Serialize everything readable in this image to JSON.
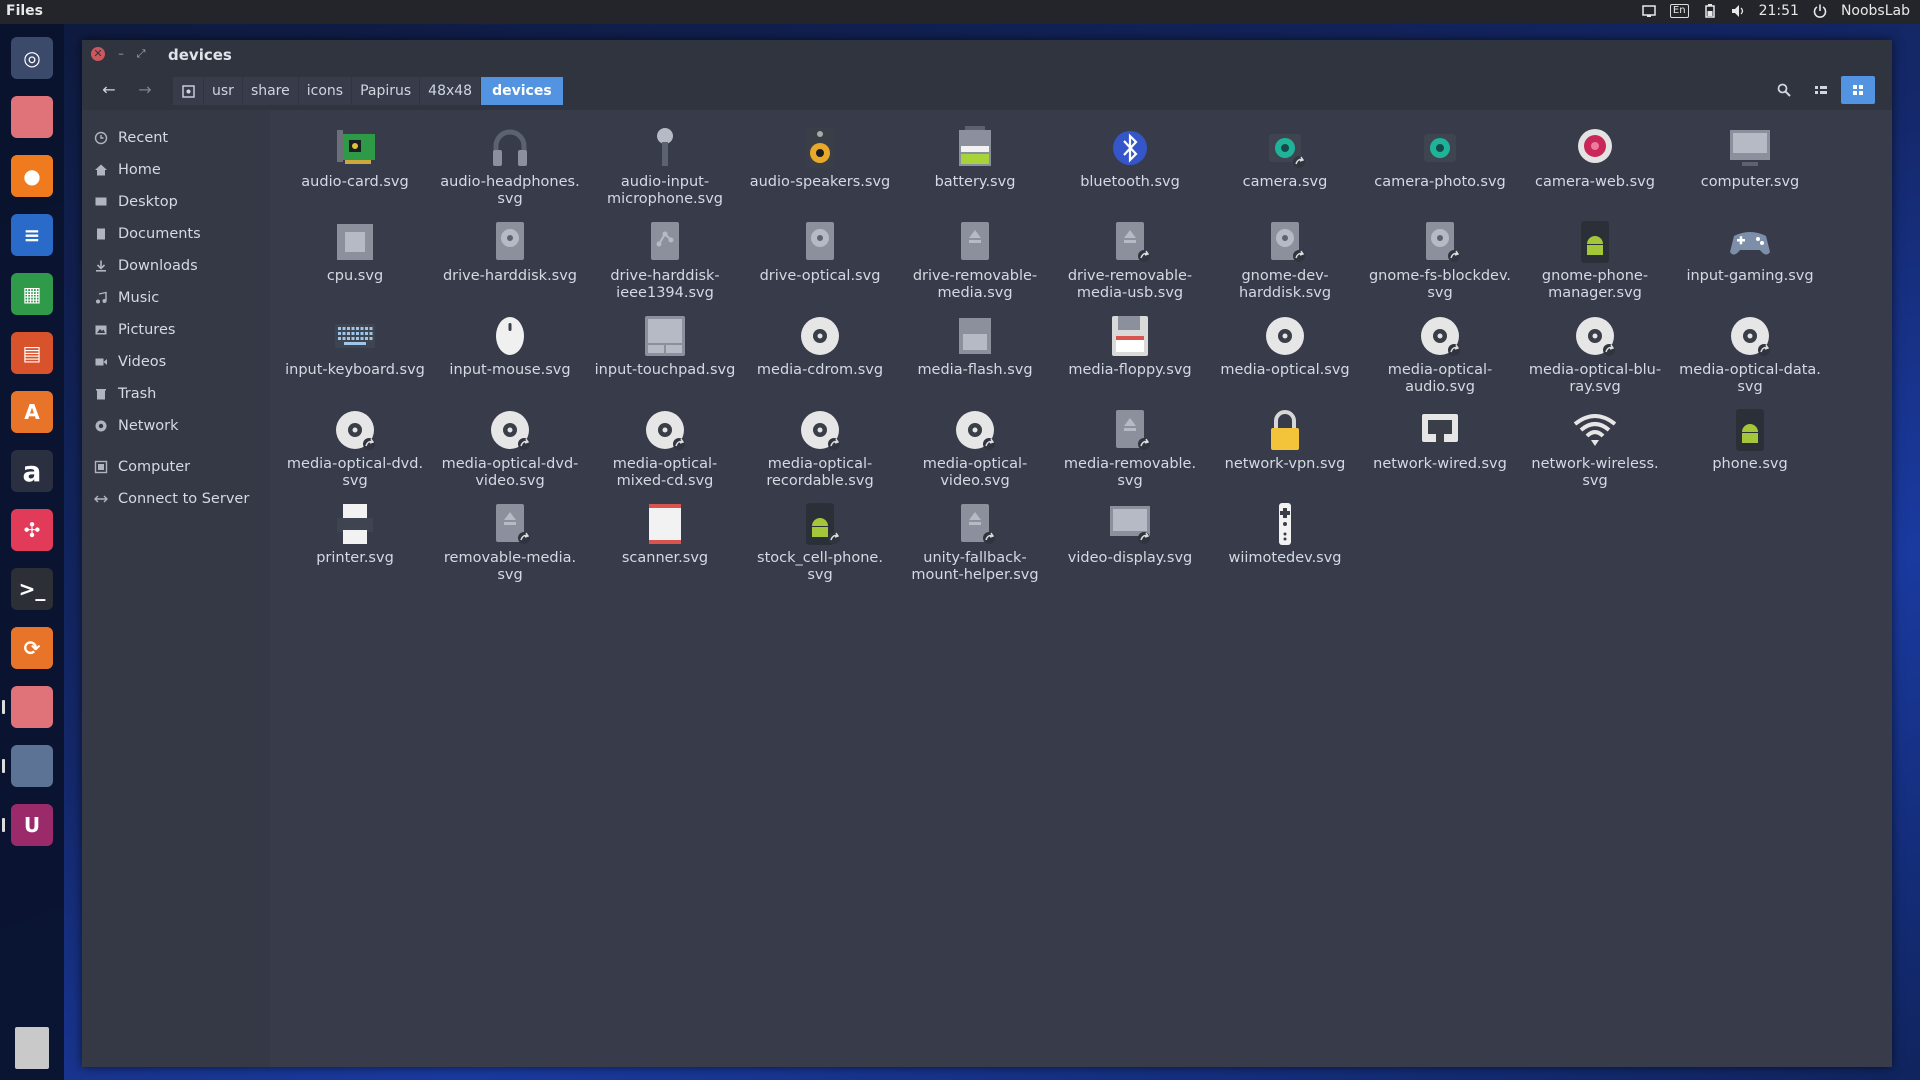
{
  "top_panel": {
    "app_name": "Files",
    "lang": "En",
    "clock": "21:51",
    "user": "NoobsLab"
  },
  "launcher": [
    {
      "name": "dash-icon",
      "color": "#3b4a6b"
    },
    {
      "name": "files-icon",
      "color": "#e0737a"
    },
    {
      "name": "firefox-icon",
      "color": "#f07b1f"
    },
    {
      "name": "writer-icon",
      "color": "#2a6ac8"
    },
    {
      "name": "calc-icon",
      "color": "#2f9a4a"
    },
    {
      "name": "impress-icon",
      "color": "#d8532c"
    },
    {
      "name": "software-center-icon",
      "color": "#e8742a"
    },
    {
      "name": "amazon-icon",
      "color": "#2b3040"
    },
    {
      "name": "slides-icon",
      "color": "#e23b5a"
    },
    {
      "name": "terminal-icon",
      "color": "#2c2f36"
    },
    {
      "name": "update-icon",
      "color": "#e8742a"
    },
    {
      "name": "files-running-icon",
      "color": "#e0737a"
    },
    {
      "name": "screenshot-icon",
      "color": "#5d7396"
    },
    {
      "name": "unity-tweak-icon",
      "color": "#9b2a6b"
    },
    {
      "name": "trash-icon",
      "color": "#c9c9c9"
    }
  ],
  "window": {
    "title": "devices",
    "breadcrumbs": [
      "usr",
      "share",
      "icons",
      "Papirus",
      "48x48",
      "devices"
    ]
  },
  "sidebar": {
    "items": [
      {
        "label": "Recent",
        "icon": "clock-icon"
      },
      {
        "label": "Home",
        "icon": "home-icon"
      },
      {
        "label": "Desktop",
        "icon": "desktop-icon"
      },
      {
        "label": "Documents",
        "icon": "documents-icon"
      },
      {
        "label": "Downloads",
        "icon": "download-icon"
      },
      {
        "label": "Music",
        "icon": "music-icon"
      },
      {
        "label": "Pictures",
        "icon": "pictures-icon"
      },
      {
        "label": "Videos",
        "icon": "videos-icon"
      },
      {
        "label": "Trash",
        "icon": "trash-icon"
      },
      {
        "label": "Network",
        "icon": "network-icon"
      },
      {
        "label": "Computer",
        "icon": "computer-icon"
      },
      {
        "label": "Connect to Server",
        "icon": "connect-server-icon"
      }
    ]
  },
  "files": [
    {
      "name": "audio-card.svg",
      "icon": "audio-card-icon"
    },
    {
      "name": "audio-headphones.svg",
      "icon": "headphones-icon"
    },
    {
      "name": "audio-input-microphone.svg",
      "icon": "microphone-icon"
    },
    {
      "name": "audio-speakers.svg",
      "icon": "speaker-icon"
    },
    {
      "name": "battery.svg",
      "icon": "battery-icon"
    },
    {
      "name": "bluetooth.svg",
      "icon": "bluetooth-icon"
    },
    {
      "name": "camera.svg",
      "icon": "camera-icon"
    },
    {
      "name": "camera-photo.svg",
      "icon": "camera-photo-icon"
    },
    {
      "name": "camera-web.svg",
      "icon": "webcam-icon"
    },
    {
      "name": "computer.svg",
      "icon": "computer-icon"
    },
    {
      "name": "cpu.svg",
      "icon": "cpu-icon"
    },
    {
      "name": "drive-harddisk.svg",
      "icon": "harddisk-icon"
    },
    {
      "name": "drive-harddisk-ieee1394.svg",
      "icon": "harddisk-ieee1394-icon"
    },
    {
      "name": "drive-optical.svg",
      "icon": "optical-drive-icon"
    },
    {
      "name": "drive-removable-media.svg",
      "icon": "removable-drive-icon"
    },
    {
      "name": "drive-removable-media-usb.svg",
      "icon": "removable-usb-icon"
    },
    {
      "name": "gnome-dev-harddisk.svg",
      "icon": "harddisk-link-icon"
    },
    {
      "name": "gnome-fs-blockdev.svg",
      "icon": "blockdev-icon"
    },
    {
      "name": "gnome-phone-manager.svg",
      "icon": "android-phone-icon"
    },
    {
      "name": "input-gaming.svg",
      "icon": "gamepad-icon"
    },
    {
      "name": "input-keyboard.svg",
      "icon": "keyboard-icon"
    },
    {
      "name": "input-mouse.svg",
      "icon": "mouse-icon"
    },
    {
      "name": "input-touchpad.svg",
      "icon": "touchpad-icon"
    },
    {
      "name": "media-cdrom.svg",
      "icon": "disc-icon"
    },
    {
      "name": "media-flash.svg",
      "icon": "flash-card-icon"
    },
    {
      "name": "media-floppy.svg",
      "icon": "floppy-icon"
    },
    {
      "name": "media-optical.svg",
      "icon": "disc-icon"
    },
    {
      "name": "media-optical-audio.svg",
      "icon": "disc-link-icon"
    },
    {
      "name": "media-optical-blu-ray.svg",
      "icon": "disc-link-icon"
    },
    {
      "name": "media-optical-data.svg",
      "icon": "disc-link-icon"
    },
    {
      "name": "media-optical-dvd.svg",
      "icon": "disc-link-icon"
    },
    {
      "name": "media-optical-dvd-video.svg",
      "icon": "disc-link-icon"
    },
    {
      "name": "media-optical-mixed-cd.svg",
      "icon": "disc-link-icon"
    },
    {
      "name": "media-optical-recordable.svg",
      "icon": "disc-link-icon"
    },
    {
      "name": "media-optical-video.svg",
      "icon": "disc-link-icon"
    },
    {
      "name": "media-removable.svg",
      "icon": "removable-drive-link-icon"
    },
    {
      "name": "network-vpn.svg",
      "icon": "lock-icon"
    },
    {
      "name": "network-wired.svg",
      "icon": "ethernet-icon"
    },
    {
      "name": "network-wireless.svg",
      "icon": "wifi-icon"
    },
    {
      "name": "phone.svg",
      "icon": "android-phone-icon"
    },
    {
      "name": "printer.svg",
      "icon": "printer-icon"
    },
    {
      "name": "removable-media.svg",
      "icon": "removable-drive-link-icon"
    },
    {
      "name": "scanner.svg",
      "icon": "scanner-icon"
    },
    {
      "name": "stock_cell-phone.svg",
      "icon": "android-phone-link-icon"
    },
    {
      "name": "unity-fallback-mount-helper.svg",
      "icon": "removable-drive-link-icon"
    },
    {
      "name": "video-display.svg",
      "icon": "display-link-icon"
    },
    {
      "name": "wiimotedev.svg",
      "icon": "wiimote-icon"
    }
  ],
  "file_labels": [
    [
      "audio-card.svg"
    ],
    [
      "audio-headphones.",
      "svg"
    ],
    [
      "audio-input-",
      "microphone.svg"
    ],
    [
      "audio-speakers.svg"
    ],
    [
      "battery.svg"
    ],
    [
      "bluetooth.svg"
    ],
    [
      "camera.svg"
    ],
    [
      "camera-photo.svg"
    ],
    [
      "camera-web.svg"
    ],
    [
      "computer.svg"
    ],
    [
      "cpu.svg"
    ],
    [
      "drive-harddisk.svg"
    ],
    [
      "drive-harddisk-",
      "ieee1394.svg"
    ],
    [
      "drive-optical.svg"
    ],
    [
      "drive-removable-",
      "media.svg"
    ],
    [
      "drive-removable-",
      "media-usb.svg"
    ],
    [
      "gnome-dev-",
      "harddisk.svg"
    ],
    [
      "gnome-fs-blockdev.",
      "svg"
    ],
    [
      "gnome-phone-",
      "manager.svg"
    ],
    [
      "input-gaming.svg"
    ],
    [
      "input-keyboard.svg"
    ],
    [
      "input-mouse.svg"
    ],
    [
      "input-touchpad.svg"
    ],
    [
      "media-cdrom.svg"
    ],
    [
      "media-flash.svg"
    ],
    [
      "media-floppy.svg"
    ],
    [
      "media-optical.svg"
    ],
    [
      "media-optical-",
      "audio.svg"
    ],
    [
      "media-optical-blu-",
      "ray.svg"
    ],
    [
      "media-optical-data.",
      "svg"
    ],
    [
      "media-optical-dvd.",
      "svg"
    ],
    [
      "media-optical-dvd-",
      "video.svg"
    ],
    [
      "media-optical-",
      "mixed-cd.svg"
    ],
    [
      "media-optical-",
      "recordable.svg"
    ],
    [
      "media-optical-",
      "video.svg"
    ],
    [
      "media-removable.",
      "svg"
    ],
    [
      "network-vpn.svg"
    ],
    [
      "network-wired.svg"
    ],
    [
      "network-wireless.",
      "svg"
    ],
    [
      "phone.svg"
    ],
    [
      "printer.svg"
    ],
    [
      "removable-media.",
      "svg"
    ],
    [
      "scanner.svg"
    ],
    [
      "stock_cell-phone.",
      "svg"
    ],
    [
      "unity-fallback-",
      "mount-helper.svg"
    ],
    [
      "video-display.svg"
    ],
    [
      "wiimotedev.svg"
    ]
  ],
  "colors": {
    "accent": "#5294e2",
    "window_bg": "#383c4a",
    "header_bg": "#2f343f",
    "sidebar_bg": "#353945"
  }
}
